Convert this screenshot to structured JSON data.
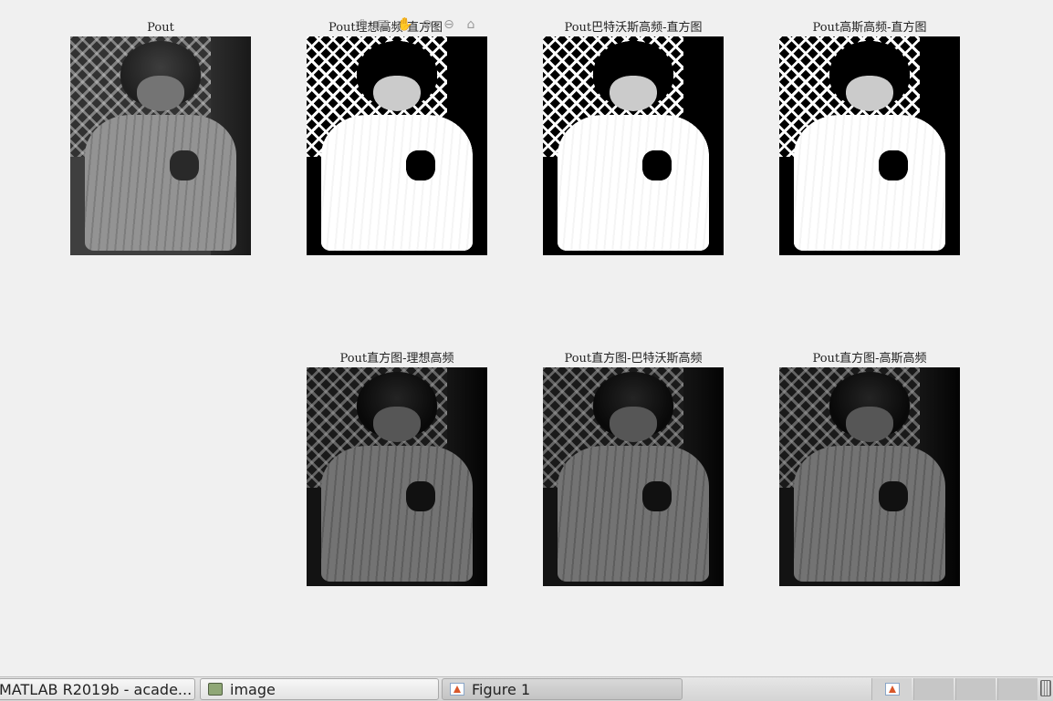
{
  "figure": {
    "subplots": [
      {
        "title": "Pout"
      },
      {
        "title": "Pout理想高频-直方图"
      },
      {
        "title": "Pout巴特沃斯高频-直方图"
      },
      {
        "title": "Pout高斯高频-直方图"
      },
      {
        "title": "Pout直方图-理想高频"
      },
      {
        "title": "Pout直方图-巴特沃斯高频"
      },
      {
        "title": "Pout直方图-高斯高频"
      }
    ],
    "toolbar": {
      "save": "⎙",
      "brush": "▤",
      "pan": "✋",
      "zoom_in": "⊕",
      "zoom_out": "⊖",
      "home": "⌂"
    }
  },
  "taskbar": {
    "items": [
      {
        "label": "MATLAB R2019b - acade..."
      },
      {
        "label": "image"
      },
      {
        "label": "Figure 1"
      }
    ]
  }
}
